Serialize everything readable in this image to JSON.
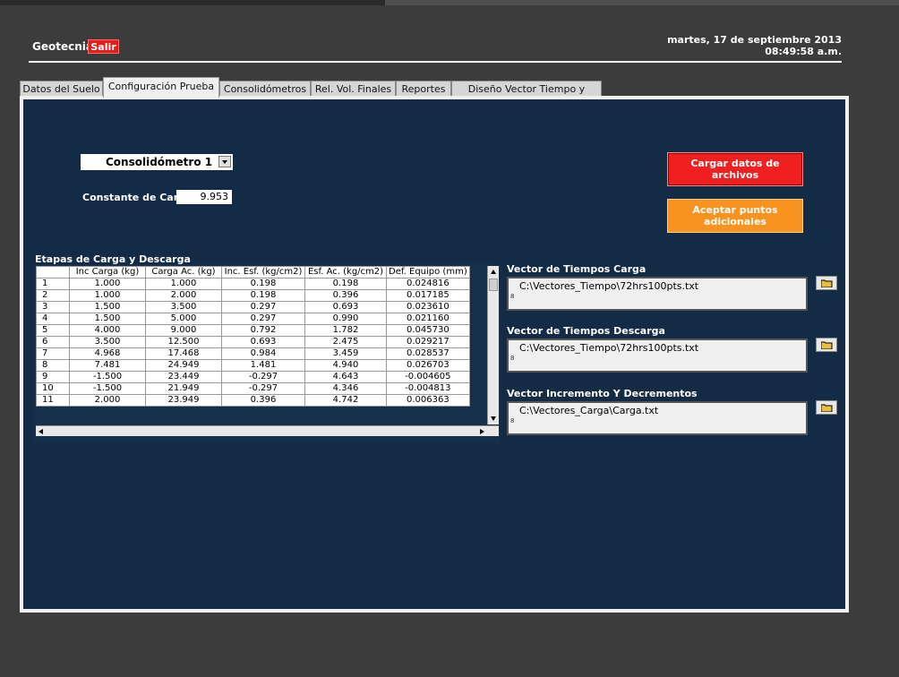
{
  "header": {
    "app_title": "Geotecnia",
    "exit_label": "Salir",
    "date": "martes, 17 de septiembre  2013",
    "time": "08:49:58 a.m."
  },
  "tabs": [
    {
      "label": "Datos del Suelo",
      "active": false
    },
    {
      "label": "Configuración Prueba",
      "active": true
    },
    {
      "label": "Consolidómetros",
      "active": false
    },
    {
      "label": "Rel. Vol. Finales",
      "active": false
    },
    {
      "label": "Reportes",
      "active": false
    },
    {
      "label": "Diseño Vector Tiempo y Carga",
      "active": false
    }
  ],
  "config": {
    "consolidometer_selected": "Consolidómetro 1",
    "load_constant_label": "Constante de Carga",
    "load_constant_value": "9.953",
    "load_files_button": "Cargar datos de archivos",
    "accept_points_button": "Aceptar puntos adicionales"
  },
  "table": {
    "title": "Etapas de Carga y Descarga",
    "headers": [
      "",
      "Inc Carga (kg)",
      "Carga Ac. (kg)",
      "Inc. Esf. (kg/cm2)",
      "Esf. Ac. (kg/cm2)",
      "Def. Equipo (mm)"
    ],
    "rows": [
      [
        "1",
        "1.000",
        "1.000",
        "0.198",
        "0.198",
        "0.024816"
      ],
      [
        "2",
        "1.000",
        "2.000",
        "0.198",
        "0.396",
        "0.017185"
      ],
      [
        "3",
        "1.500",
        "3.500",
        "0.297",
        "0.693",
        "0.023610"
      ],
      [
        "4",
        "1.500",
        "5.000",
        "0.297",
        "0.990",
        "0.021160"
      ],
      [
        "5",
        "4.000",
        "9.000",
        "0.792",
        "1.782",
        "0.045730"
      ],
      [
        "6",
        "3.500",
        "12.500",
        "0.693",
        "2.475",
        "0.029217"
      ],
      [
        "7",
        "4.968",
        "17.468",
        "0.984",
        "3.459",
        "0.028537"
      ],
      [
        "8",
        "7.481",
        "24.949",
        "1.481",
        "4.940",
        "0.026703"
      ],
      [
        "9",
        "-1.500",
        "23.449",
        "-0.297",
        "4.643",
        "-0.004605"
      ],
      [
        "10",
        "-1.500",
        "21.949",
        "-0.297",
        "4.346",
        "-0.004813"
      ],
      [
        "11",
        "2.000",
        "23.949",
        "0.396",
        "4.742",
        "0.006363"
      ]
    ]
  },
  "files": [
    {
      "label": "Vector de Tiempos Carga",
      "path": "C:\\Vectores_Tiempo\\72hrs100pts.txt",
      "tag": "8"
    },
    {
      "label": "Vector de Tiempos Descarga",
      "path": "C:\\Vectores_Tiempo\\72hrs100pts.txt",
      "tag": "8"
    },
    {
      "label": "Vector Incremento Y Decrementos",
      "path": "C:\\Vectores_Carga\\Carga.txt",
      "tag": "8"
    }
  ],
  "colors": {
    "panel_bg": "#142b45",
    "red_button": "#f02020",
    "orange_button": "#f7931e",
    "exit_button": "#e41c1c"
  }
}
